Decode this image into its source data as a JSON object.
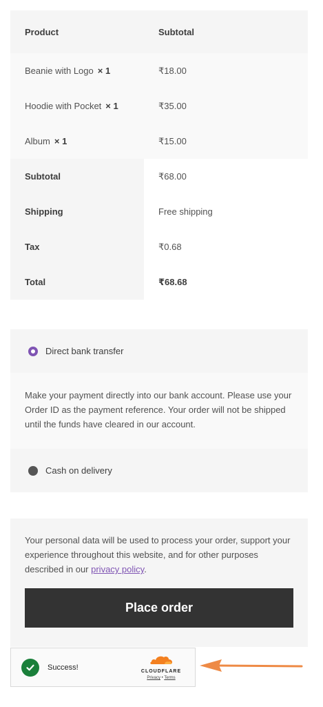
{
  "order_review": {
    "header": {
      "product": "Product",
      "subtotal": "Subtotal"
    },
    "items": [
      {
        "name": "Beanie with Logo",
        "qty": "× 1",
        "price": "₹18.00"
      },
      {
        "name": "Hoodie with Pocket",
        "qty": "× 1",
        "price": "₹35.00"
      },
      {
        "name": "Album",
        "qty": "× 1",
        "price": "₹15.00"
      }
    ],
    "totals": [
      {
        "label": "Subtotal",
        "value": "₹68.00"
      },
      {
        "label": "Shipping",
        "value": "Free shipping"
      },
      {
        "label": "Tax",
        "value": "₹0.68"
      },
      {
        "label": "Total",
        "value": "₹68.68"
      }
    ]
  },
  "payment": {
    "methods": [
      {
        "label": "Direct bank transfer",
        "selected": true
      },
      {
        "label": "Cash on delivery",
        "selected": false
      }
    ],
    "description": "Make your payment directly into our bank account. Please use your Order ID as the payment reference. Your order will not be shipped until the funds have cleared in our account."
  },
  "privacy": {
    "text_before": "Your personal data will be used to process your order, support your experience throughout this website, and for other purposes described in our ",
    "link": "privacy policy",
    "text_after": "."
  },
  "place_order_label": "Place order",
  "turnstile": {
    "status": "Success!",
    "brand": "CLOUDFLARE",
    "privacy_link": "Privacy",
    "separator": "•",
    "terms_link": "Terms"
  },
  "colors": {
    "accent": "#7f54b3",
    "button_bg": "#333333",
    "success": "#1a7f3a",
    "cloudflare_orange": "#f38020",
    "arrow": "#ee8a45"
  }
}
